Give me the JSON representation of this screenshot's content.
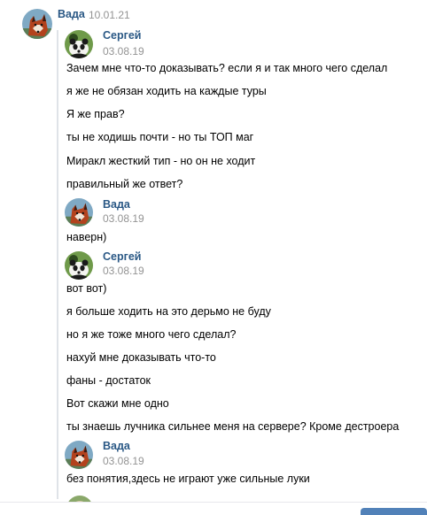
{
  "header": {
    "author": "Вада",
    "date": "10.01.21"
  },
  "forwarded": [
    {
      "author": "Сергей",
      "date": "03.08.19",
      "avatar_icon": "panda-avatar",
      "messages": [
        "Зачем мне что-то доказывать? если я и так много чего сделал",
        "я же не обязан ходить на каждые туры",
        "Я же прав?",
        "ты не ходишь почти - но ты ТОП маг",
        "Миракл жесткий тип - но он не ходит",
        "правильный же ответ?"
      ]
    },
    {
      "author": "Вада",
      "date": "03.08.19",
      "avatar_icon": "fox-avatar",
      "messages": [
        "наверн)"
      ]
    },
    {
      "author": "Сергей",
      "date": "03.08.19",
      "avatar_icon": "panda-avatar",
      "messages": [
        "вот вот)",
        "я больше ходить на это дерьмо не буду",
        "но я же тоже много чего сделал?",
        "нахуй мне доказывать что-то",
        "фаны - достаток",
        "Вот скажи мне одно",
        "ты знаешь лучника сильнее меня на сервере? Кроме дестроера"
      ]
    },
    {
      "author": "Вада",
      "date": "03.08.19",
      "avatar_icon": "fox-avatar",
      "messages": [
        "без понятия,здесь не играют уже сильные луки"
      ]
    }
  ],
  "colors": {
    "author_name": "#2a5885",
    "date": "#939393",
    "forward_bar": "#dfe3e8",
    "send_button": "#5181b8"
  }
}
